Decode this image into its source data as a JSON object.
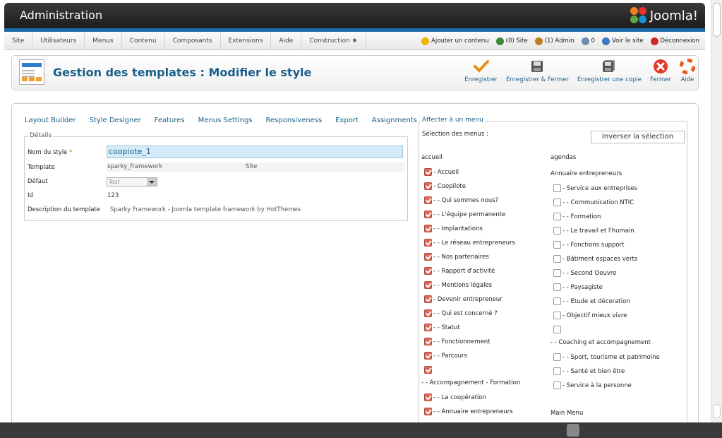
{
  "header": {
    "title": "Administration",
    "logo_text": "Joomla!"
  },
  "menu": {
    "left": [
      "Site",
      "Utilisateurs",
      "Menus",
      "Contenu",
      "Composants",
      "Extensions",
      "Aide",
      "Construction ★"
    ],
    "right": [
      {
        "label": "Ajouter un contenu",
        "icon": "add-content-icon",
        "color": "#f0b400"
      },
      {
        "label": "(0) Site",
        "icon": "users-icon",
        "color": "#3a8a3a"
      },
      {
        "label": "(1) Admin",
        "icon": "users-icon",
        "color": "#c07a20"
      },
      {
        "label": "0",
        "icon": "messages-icon",
        "color": "#6b8bb0"
      },
      {
        "label": "Voir le site",
        "icon": "view-site-icon",
        "color": "#3a7ac0"
      },
      {
        "label": "Déconnexion",
        "icon": "logout-icon",
        "color": "#d02a20"
      }
    ]
  },
  "toolbar": {
    "title": "Gestion des templates : Modifier le style",
    "save": "Enregistrer",
    "save_close": "Enregistrer & Fermer",
    "save_copy": "Enregistrer une copie",
    "close": "Fermer",
    "help": "Aide"
  },
  "tabs": [
    "Layout Builder",
    "Style Designer",
    "Features",
    "Menus Settings",
    "Responsiveness",
    "Export",
    "Assignments"
  ],
  "details": {
    "legend": "Détails",
    "name_label": "Nom du style",
    "required_mark": "*",
    "name_value": "coopiote_1",
    "template_label": "Template",
    "template_value": "sparky_framework",
    "template_location": "Site",
    "default_label": "Défaut",
    "default_value": "Tout",
    "id_label": "Id",
    "id_value": "123",
    "desc_label": "Description du template",
    "desc_value": "Sparky Framework - Joomla template framework by HotThemes"
  },
  "assignment": {
    "legend": "Affecter à un menu",
    "selection_label": "Sélection des menus :",
    "invert_button": "Inverser la sélection",
    "col1_heading": "accueil",
    "col1": [
      {
        "label": "- Accueil",
        "checked": true
      },
      {
        "label": "- Coopilote",
        "checked": true
      },
      {
        "label": "- - Qui sommes nous?",
        "checked": true
      },
      {
        "label": "- - L'équipe permanente",
        "checked": true
      },
      {
        "label": "- - Implantations",
        "checked": true
      },
      {
        "label": "- - Le réseau entrepreneurs",
        "checked": true
      },
      {
        "label": "- - Nos partenaires",
        "checked": true
      },
      {
        "label": "- - Rapport d'activité",
        "checked": true
      },
      {
        "label": "- - Mentions légales",
        "checked": true
      },
      {
        "label": "- Devenir entrepreneur",
        "checked": true
      },
      {
        "label": "- - Qui est concerné ?",
        "checked": true
      },
      {
        "label": "- - Statut",
        "checked": true
      },
      {
        "label": "- - Fonctionnement",
        "checked": true
      },
      {
        "label": "- - Parcours",
        "checked": true
      },
      {
        "label": "",
        "checked": true
      }
    ],
    "col1_subheading": "- - Accompagnement - Formation",
    "col1_after": [
      {
        "label": "- - La coopération",
        "checked": true
      },
      {
        "label": "- - Annuaire entrepreneurs",
        "checked": true
      }
    ],
    "col2_heading": "agendas",
    "col2_subheading": "Annuaire entrepreneurs",
    "col2": [
      {
        "label": "- Service aux entreprises",
        "checked": false
      },
      {
        "label": "- - Communication NTIC",
        "checked": false
      },
      {
        "label": "- - Formation",
        "checked": false
      },
      {
        "label": "- - Le travail et l'humain",
        "checked": false
      },
      {
        "label": "- - Fonctions support",
        "checked": false
      },
      {
        "label": "- Bâtiment espaces verts",
        "checked": false
      },
      {
        "label": "- - Second Oeuvre",
        "checked": false
      },
      {
        "label": "- - Paysagiste",
        "checked": false
      },
      {
        "label": "- - Etude et décoration",
        "checked": false
      },
      {
        "label": "- Objectif mieux vivre",
        "checked": false
      },
      {
        "label": "",
        "checked": false
      }
    ],
    "col2_subheading2": "- - Coaching et accompagnement",
    "col2_after": [
      {
        "label": "- - Sport, tourisme et patrimoine",
        "checked": false
      },
      {
        "label": "- - Santé et bien être",
        "checked": false
      },
      {
        "label": "- Service à la personne",
        "checked": false
      }
    ],
    "col2_heading3": "Main Menu"
  }
}
